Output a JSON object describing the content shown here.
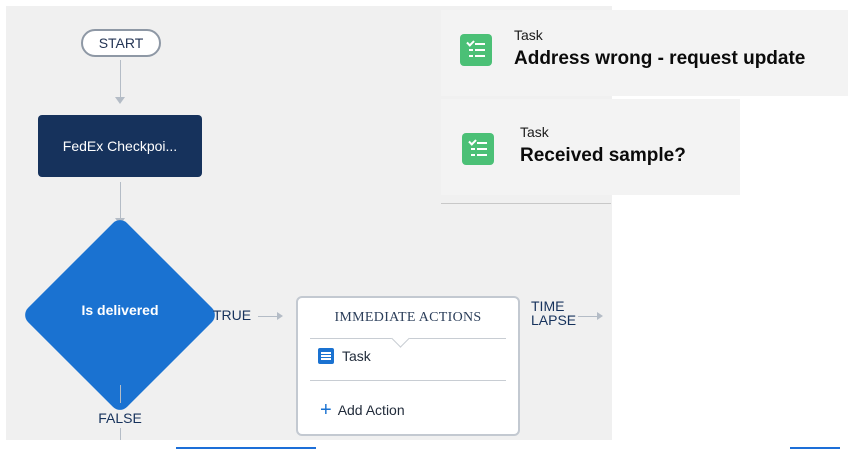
{
  "flow": {
    "start_label": "START",
    "criteria_label": "FedEx Checkpoi...",
    "decision_label": "Is delivered",
    "true_label": "TRUE",
    "false_label": "FALSE",
    "time_lapse_line1": "TIME",
    "time_lapse_line2": "LAPSE"
  },
  "immediate_actions": {
    "header": "IMMEDIATE ACTIONS",
    "items": [
      {
        "icon": "task-list-icon",
        "label": "Task"
      }
    ],
    "add_action_label": "Add Action"
  },
  "task_tiles": [
    {
      "icon": "task-checklist-icon",
      "type_label": "Task",
      "title": "Address wrong - request update"
    },
    {
      "icon": "task-checklist-icon",
      "type_label": "Task",
      "title": "Received sample?"
    }
  ],
  "colors": {
    "canvas": "#f0f0f0",
    "criteria_node": "#16325c",
    "decision_node": "#1a72d1",
    "task_icon_green": "#4bc076",
    "accent_blue": "#1a72d1"
  }
}
